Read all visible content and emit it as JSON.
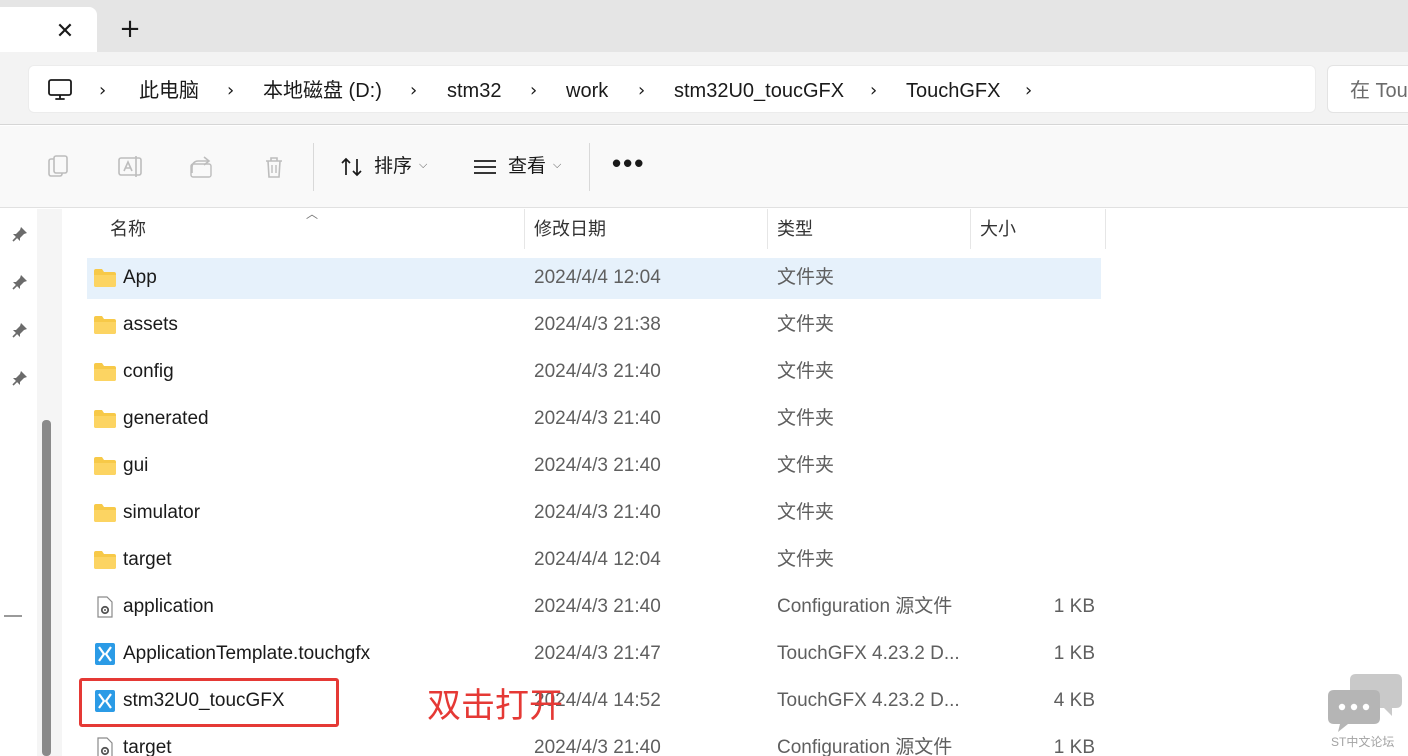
{
  "tabs": {
    "close_glyph": "✕",
    "new_tab_glyph": "+"
  },
  "breadcrumb": {
    "chevron": "›",
    "items": [
      "此电脑",
      "本地磁盘 (D:)",
      "stm32",
      "work",
      "stm32U0_toucGFX",
      "TouchGFX"
    ]
  },
  "search": {
    "placeholder": "在 TouchGFX 中搜索"
  },
  "toolbar": {
    "sort_label": "排序",
    "view_label": "查看",
    "more_label": "•••",
    "icons": [
      "copy-icon",
      "rename-icon",
      "share-icon",
      "delete-icon",
      "sort-icon",
      "view-icon"
    ]
  },
  "columns": {
    "name": "名称",
    "date": "修改日期",
    "type": "类型",
    "size": "大小"
  },
  "files": [
    {
      "name": "App",
      "date": "2024/4/4 12:04",
      "type": "文件夹",
      "size": "",
      "icon": "folder-icon",
      "selected": true
    },
    {
      "name": "assets",
      "date": "2024/4/3 21:38",
      "type": "文件夹",
      "size": "",
      "icon": "folder-icon"
    },
    {
      "name": "config",
      "date": "2024/4/3 21:40",
      "type": "文件夹",
      "size": "",
      "icon": "folder-icon"
    },
    {
      "name": "generated",
      "date": "2024/4/3 21:40",
      "type": "文件夹",
      "size": "",
      "icon": "folder-icon"
    },
    {
      "name": "gui",
      "date": "2024/4/3 21:40",
      "type": "文件夹",
      "size": "",
      "icon": "folder-icon"
    },
    {
      "name": "simulator",
      "date": "2024/4/3 21:40",
      "type": "文件夹",
      "size": "",
      "icon": "folder-icon"
    },
    {
      "name": "target",
      "date": "2024/4/4 12:04",
      "type": "文件夹",
      "size": "",
      "icon": "folder-icon"
    },
    {
      "name": "application",
      "date": "2024/4/3 21:40",
      "type": "Configuration 源文件",
      "size": "1 KB",
      "icon": "config-file-icon"
    },
    {
      "name": "ApplicationTemplate.touchgfx",
      "date": "2024/4/3 21:47",
      "type": "TouchGFX 4.23.2 D...",
      "size": "1 KB",
      "icon": "touchgfx-file-icon"
    },
    {
      "name": "stm32U0_toucGFX",
      "date": "2024/4/4 14:52",
      "type": "TouchGFX 4.23.2 D...",
      "size": "4 KB",
      "icon": "touchgfx-file-icon"
    },
    {
      "name": "target",
      "date": "2024/4/3 21:40",
      "type": "Configuration 源文件",
      "size": "1 KB",
      "icon": "config-file-icon"
    }
  ],
  "annotation": {
    "text": "双击打开",
    "color": "#e53935"
  },
  "watermark": {
    "text": "ST中文论坛"
  },
  "colors": {
    "selection": "#e6f1fb",
    "folder": "#f7c948",
    "touchgfx": "#2b9be6",
    "annotation": "#e53935"
  }
}
